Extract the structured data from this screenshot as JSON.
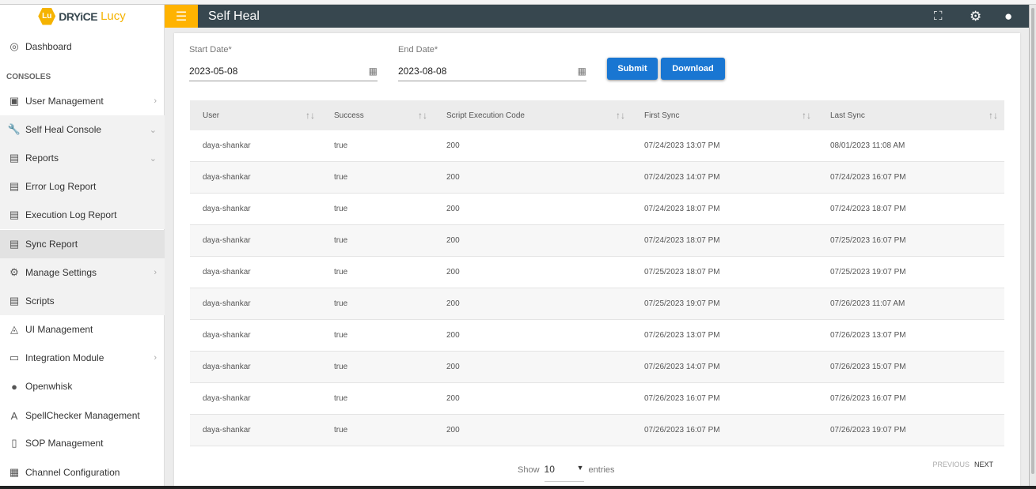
{
  "logo": {
    "badge": "Lu",
    "brand": "DRYiCE",
    "product": "Lucy"
  },
  "header": {
    "title": "Self Heal",
    "icons": [
      "fullscreen-icon",
      "settings-icon",
      "account-icon"
    ]
  },
  "sidebar": {
    "section": "CONSOLES",
    "items": [
      {
        "label": "Dashboard",
        "icon": "◎"
      },
      {
        "label": "User Management",
        "icon": "▣",
        "chev": "›"
      },
      {
        "label": "Self Heal Console",
        "icon": "🔧",
        "chev": "⌄"
      },
      {
        "label": "Reports",
        "icon": "▤",
        "chev": "⌄"
      },
      {
        "label": "Error Log Report",
        "icon": "▤"
      },
      {
        "label": "Execution Log Report",
        "icon": "▤"
      },
      {
        "label": "Sync Report",
        "icon": "▤"
      },
      {
        "label": "Manage Settings",
        "icon": "⚙",
        "chev": "›"
      },
      {
        "label": "Scripts",
        "icon": "▤"
      },
      {
        "label": "UI Management",
        "icon": "◬"
      },
      {
        "label": "Integration Module",
        "icon": "▭",
        "chev": "›"
      },
      {
        "label": "Openwhisk",
        "icon": "●"
      },
      {
        "label": "SpellChecker Management",
        "icon": "A"
      },
      {
        "label": "SOP Management",
        "icon": "▯"
      },
      {
        "label": "Channel Configuration",
        "icon": "▦"
      }
    ]
  },
  "form": {
    "start_label": "Start Date*",
    "start_value": "2023-05-08",
    "end_label": "End Date*",
    "end_value": "2023-08-08",
    "submit": "Submit",
    "download": "Download"
  },
  "table": {
    "headers": [
      "User",
      "Success",
      "Script Execution Code",
      "First Sync",
      "Last Sync"
    ],
    "rows": [
      [
        "daya-shankar",
        "true",
        "200",
        "07/24/2023 13:07 PM",
        "08/01/2023 11:08 AM"
      ],
      [
        "daya-shankar",
        "true",
        "200",
        "07/24/2023 14:07 PM",
        "07/24/2023 16:07 PM"
      ],
      [
        "daya-shankar",
        "true",
        "200",
        "07/24/2023 18:07 PM",
        "07/24/2023 18:07 PM"
      ],
      [
        "daya-shankar",
        "true",
        "200",
        "07/24/2023 18:07 PM",
        "07/25/2023 16:07 PM"
      ],
      [
        "daya-shankar",
        "true",
        "200",
        "07/25/2023 18:07 PM",
        "07/25/2023 19:07 PM"
      ],
      [
        "daya-shankar",
        "true",
        "200",
        "07/25/2023 19:07 PM",
        "07/26/2023 11:07 AM"
      ],
      [
        "daya-shankar",
        "true",
        "200",
        "07/26/2023 13:07 PM",
        "07/26/2023 13:07 PM"
      ],
      [
        "daya-shankar",
        "true",
        "200",
        "07/26/2023 14:07 PM",
        "07/26/2023 15:07 PM"
      ],
      [
        "daya-shankar",
        "true",
        "200",
        "07/26/2023 16:07 PM",
        "07/26/2023 16:07 PM"
      ],
      [
        "daya-shankar",
        "true",
        "200",
        "07/26/2023 16:07 PM",
        "07/26/2023 19:07 PM"
      ]
    ]
  },
  "footer": {
    "show": "Show",
    "entries_value": "10",
    "entries": "entries",
    "previous": "PREVIOUS",
    "next": "NEXT"
  }
}
